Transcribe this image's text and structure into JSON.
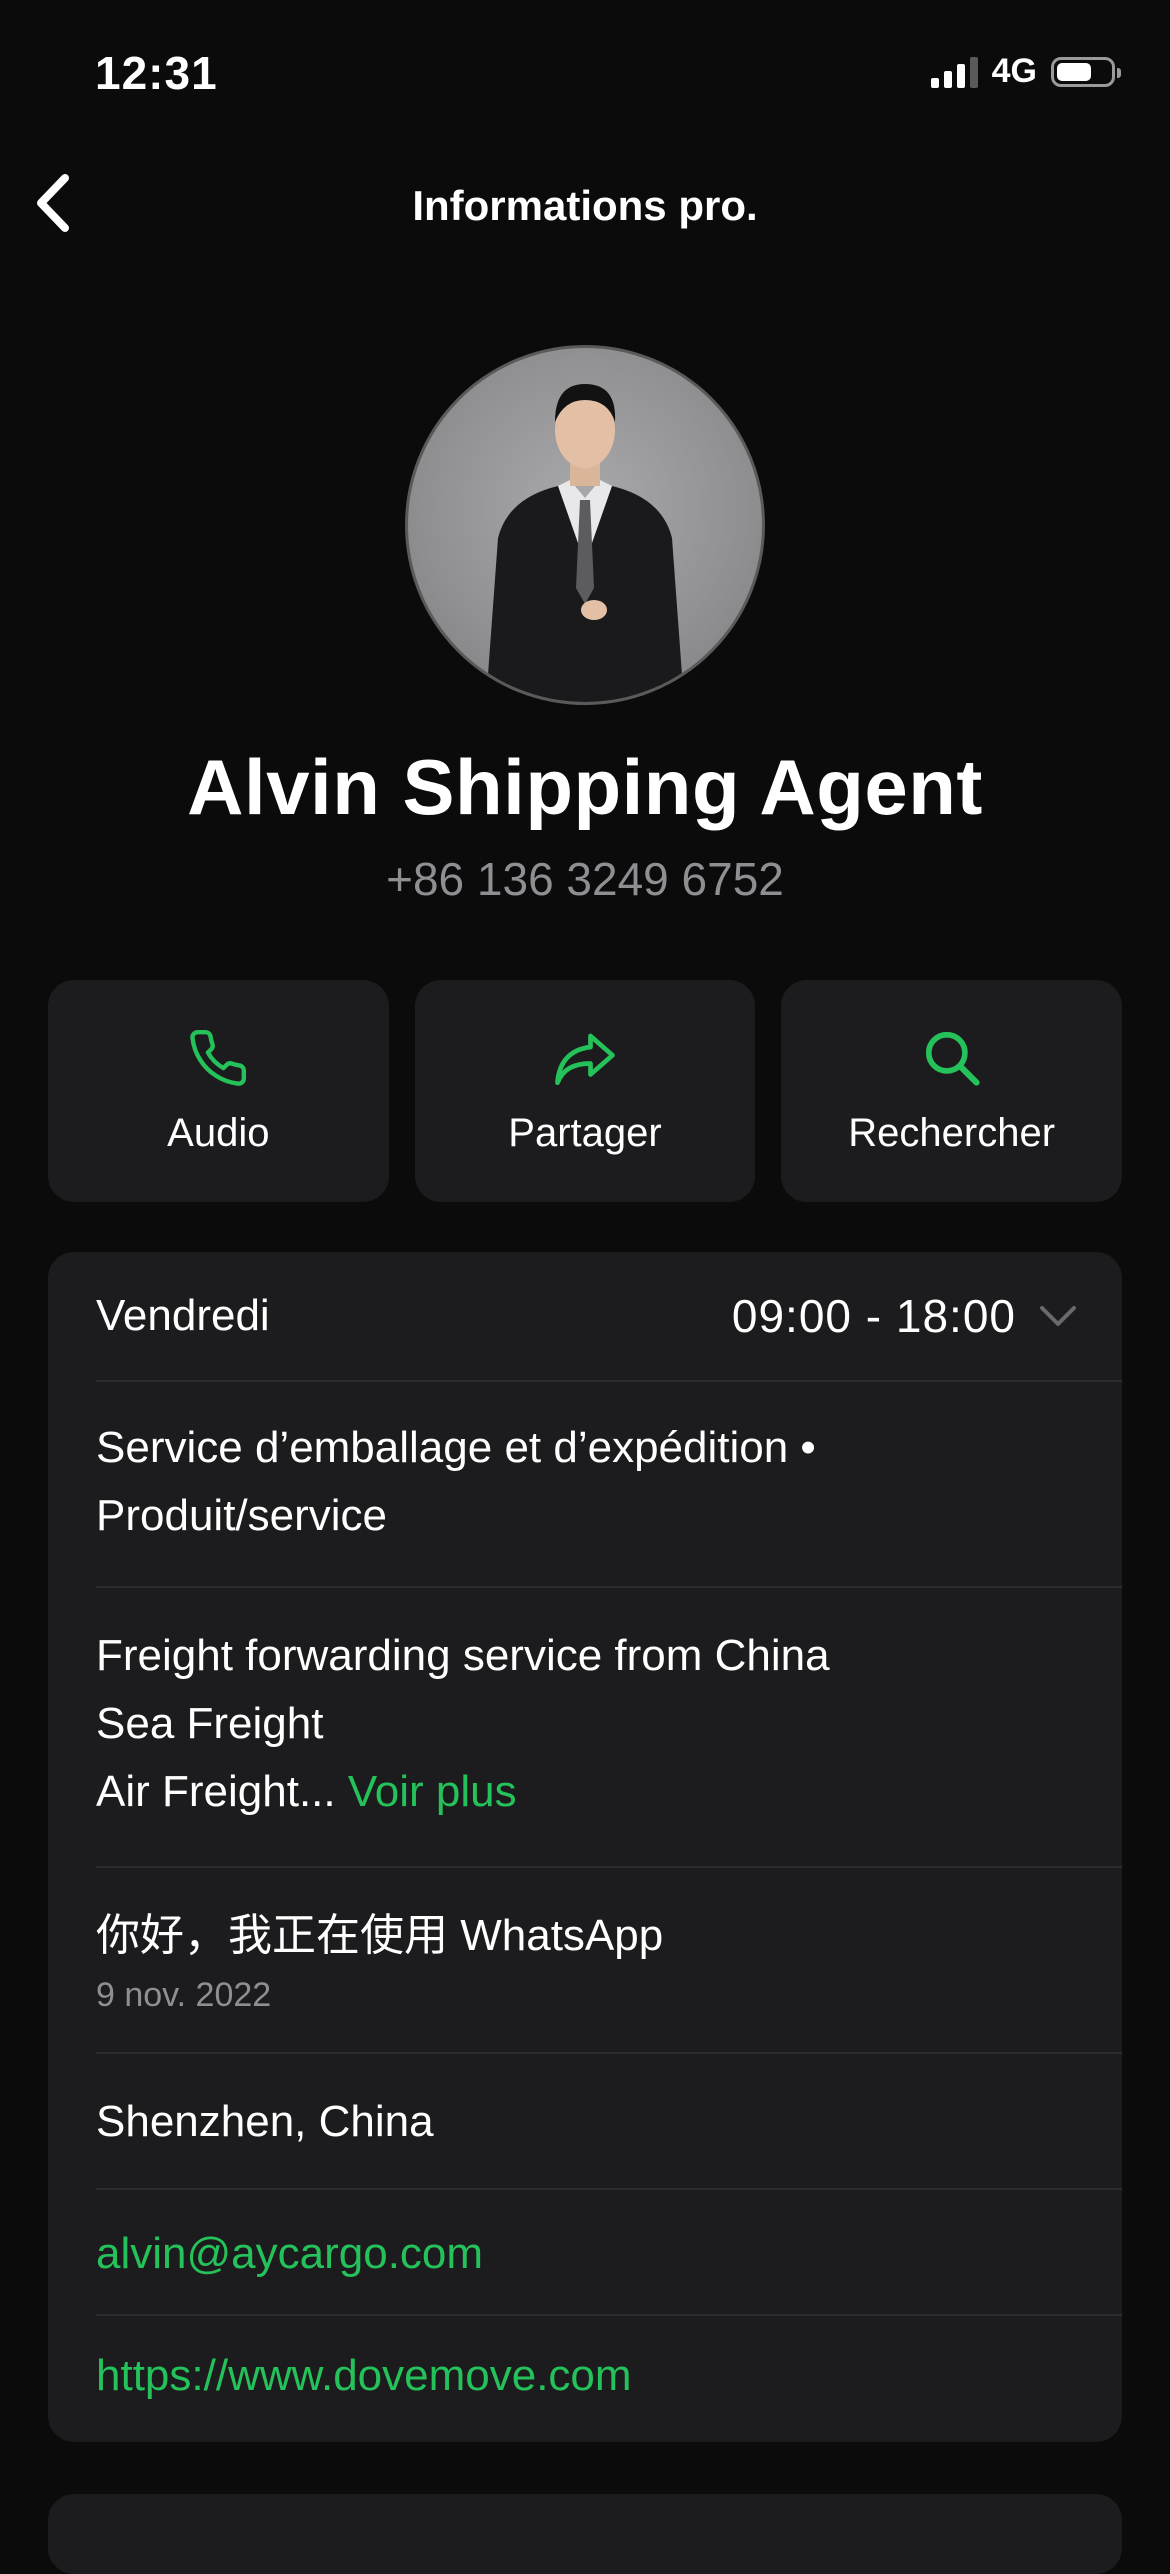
{
  "status_bar": {
    "time": "12:31",
    "network": "4G"
  },
  "nav": {
    "title": "Informations pro."
  },
  "profile": {
    "name": "Alvin Shipping Agent",
    "phone": "+86 136 3249 6752"
  },
  "actions": [
    {
      "label": "Audio",
      "icon": "phone-icon"
    },
    {
      "label": "Partager",
      "icon": "share-arrow-icon"
    },
    {
      "label": "Rechercher",
      "icon": "search-icon"
    }
  ],
  "info": {
    "hours_day": "Vendredi",
    "hours_time": "09:00 - 18:00",
    "category_line1": "Service d’emballage et d’expédition •",
    "category_line2": "Produit/service",
    "description_line1": "Freight forwarding service from China",
    "description_line2": "Sea Freight",
    "description_line3": "Air Freight...",
    "see_more": "Voir plus",
    "about": "你好，我正在使用 WhatsApp",
    "about_date": "9 nov. 2022",
    "location": "Shenzhen, China",
    "email": "alvin@aycargo.com",
    "website": "https://www.dovemove.com"
  },
  "colors": {
    "background": "#0b0b0b",
    "card": "#1c1c1e",
    "accent": "#25c15a",
    "secondary_text": "#8e8e93"
  }
}
